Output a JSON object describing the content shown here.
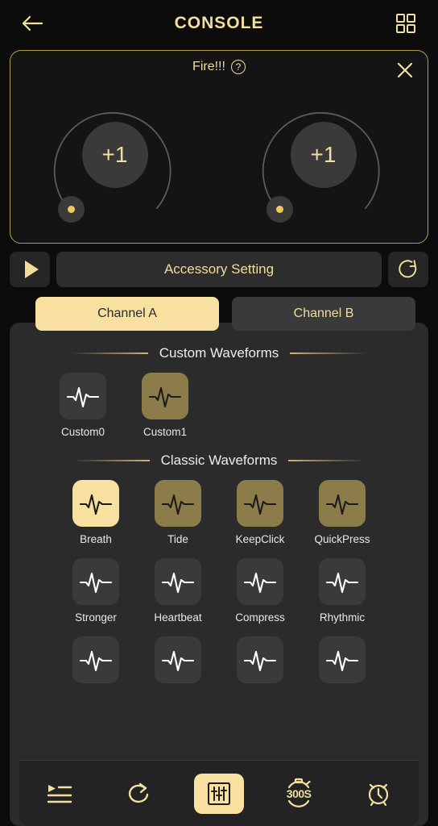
{
  "header": {
    "title": "CONSOLE",
    "back_icon": "arrow-left-icon",
    "grid_icon": "grid-2x2-icon"
  },
  "dial_panel": {
    "title": "Fire!!!",
    "help_icon": "question-mark-icon",
    "close_icon": "close-icon",
    "dials": [
      {
        "name": "dial-a",
        "value": "+1"
      },
      {
        "name": "dial-b",
        "value": "+1"
      }
    ]
  },
  "accessory": {
    "play_icon": "play-icon",
    "label": "Accessory Setting",
    "refresh_icon": "refresh-icon"
  },
  "channels": [
    {
      "label": "Channel A",
      "active": true
    },
    {
      "label": "Channel B",
      "active": false
    }
  ],
  "custom_section": {
    "title": "Custom Waveforms",
    "items": [
      {
        "label": "Custom0",
        "state": "dark"
      },
      {
        "label": "Custom1",
        "state": "olive"
      }
    ]
  },
  "classic_section": {
    "title": "Classic Waveforms",
    "items": [
      {
        "label": "Breath",
        "state": "selected"
      },
      {
        "label": "Tide",
        "state": "olive"
      },
      {
        "label": "KeepClick",
        "state": "olive"
      },
      {
        "label": "QuickPress",
        "state": "olive"
      },
      {
        "label": "Stronger",
        "state": "dark"
      },
      {
        "label": "Heartbeat",
        "state": "dark"
      },
      {
        "label": "Compress",
        "state": "dark"
      },
      {
        "label": "Rhythmic",
        "state": "dark"
      },
      {
        "label": "",
        "state": "dark"
      },
      {
        "label": "",
        "state": "dark"
      },
      {
        "label": "",
        "state": "dark"
      },
      {
        "label": "",
        "state": "dark"
      }
    ]
  },
  "bottom_nav": [
    {
      "name": "playlist-icon",
      "label": "",
      "active": false
    },
    {
      "name": "loop-icon",
      "label": "",
      "active": false
    },
    {
      "name": "sliders-icon",
      "label": "",
      "active": true
    },
    {
      "name": "stopwatch-icon",
      "label": "300S",
      "active": false
    },
    {
      "name": "alarm-clock-icon",
      "label": "",
      "active": false
    }
  ],
  "colors": {
    "accent": "#f7e0a0",
    "gold": "#f0dda0",
    "olive": "#8c7c4a",
    "panel": "#2b2b2b",
    "background": "#0c0c0c"
  }
}
